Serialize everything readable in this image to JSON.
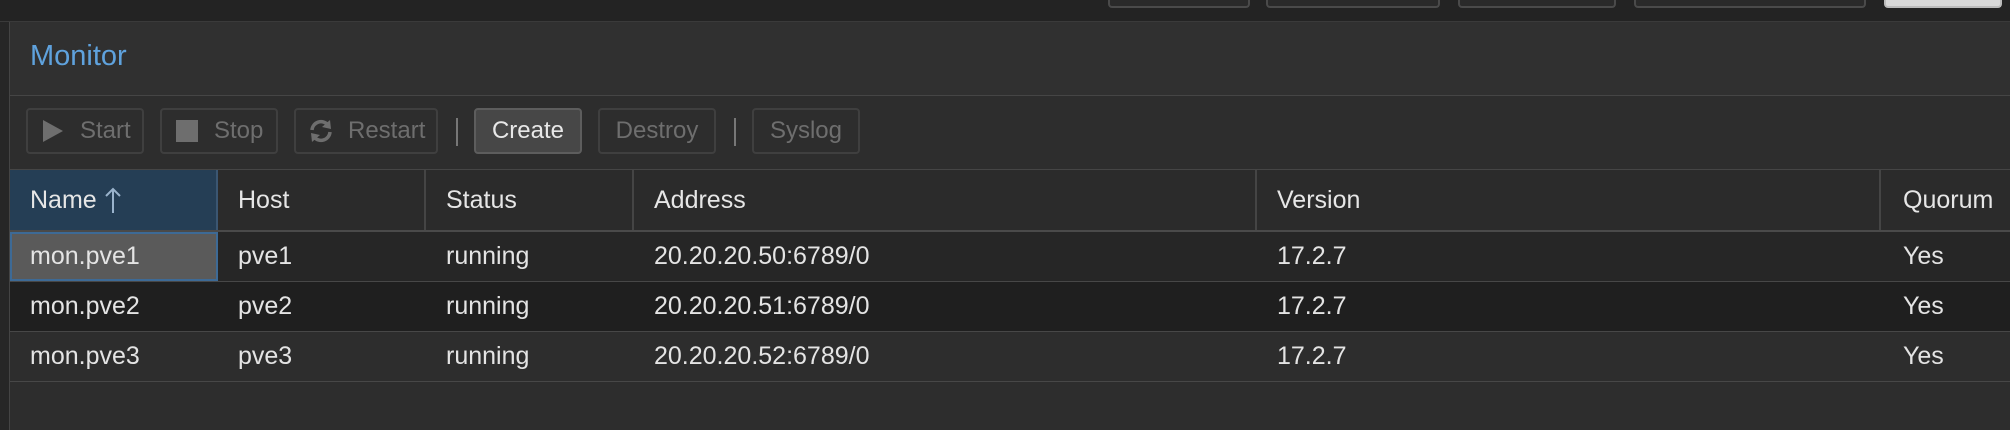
{
  "panel": {
    "title": "Monitor"
  },
  "toolbar": {
    "start_label": "Start",
    "stop_label": "Stop",
    "restart_label": "Restart",
    "create_label": "Create",
    "destroy_label": "Destroy",
    "syslog_label": "Syslog"
  },
  "grid": {
    "columns": [
      "Name",
      "Host",
      "Status",
      "Address",
      "Version",
      "Quorum"
    ],
    "sorted_column": "Name",
    "sort_direction": "ascending",
    "rows": [
      {
        "name": "mon.pve1",
        "host": "pve1",
        "status": "running",
        "address": "20.20.20.50:6789/0",
        "version": "17.2.7",
        "quorum": "Yes"
      },
      {
        "name": "mon.pve2",
        "host": "pve2",
        "status": "running",
        "address": "20.20.20.51:6789/0",
        "version": "17.2.7",
        "quorum": "Yes"
      },
      {
        "name": "mon.pve3",
        "host": "pve3",
        "status": "running",
        "address": "20.20.20.52:6789/0",
        "version": "17.2.7",
        "quorum": "Yes"
      }
    ]
  },
  "icons": {
    "start": "play-icon",
    "stop": "stop-icon",
    "restart": "refresh-icon",
    "sort": "arrow-up-icon"
  },
  "colors": {
    "accent": "#5fa2dd",
    "selected_header": "#253e55",
    "selected_cell": "#5a5a5a"
  }
}
